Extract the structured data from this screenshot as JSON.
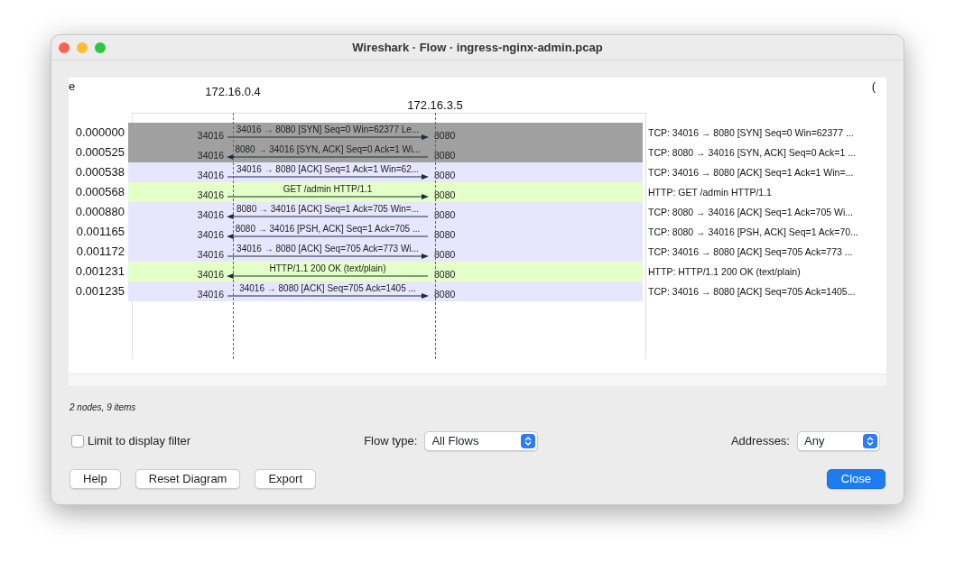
{
  "window": {
    "title": "Wireshark · Flow · ingress-nginx-admin.pcap"
  },
  "columns": {
    "column_1": "e",
    "column_2": "("
  },
  "nodes": [
    {
      "address": "172.16.0.4"
    },
    {
      "address": "172.16.3.5"
    }
  ],
  "rows": [
    {
      "time": "0.000000",
      "left_port": "34016",
      "right_port": "8080",
      "label": "34016 → 8080 [SYN] Seq=0 Win=62377 Le...",
      "rightward": true,
      "color": "#a0a0a0",
      "comment": "TCP: 34016 → 8080 [SYN] Seq=0 Win=62377 ..."
    },
    {
      "time": "0.000525",
      "left_port": "34016",
      "right_port": "8080",
      "label": "8080 → 34016 [SYN, ACK] Seq=0 Ack=1 Wi...",
      "rightward": false,
      "color": "#a0a0a0",
      "comment": "TCP: 8080 → 34016 [SYN, ACK] Seq=0 Ack=1 ..."
    },
    {
      "time": "0.000538",
      "left_port": "34016",
      "right_port": "8080",
      "label": "34016 → 8080 [ACK] Seq=1 Ack=1 Win=62...",
      "rightward": true,
      "color": "#e7e6ff",
      "comment": "TCP: 34016 → 8080 [ACK] Seq=1 Ack=1 Win=..."
    },
    {
      "time": "0.000568",
      "left_port": "34016",
      "right_port": "8080",
      "label": "GET /admin HTTP/1.1",
      "rightward": true,
      "color": "#e4ffc7",
      "comment": "HTTP: GET /admin HTTP/1.1"
    },
    {
      "time": "0.000880",
      "left_port": "34016",
      "right_port": "8080",
      "label": "8080 → 34016 [ACK] Seq=1 Ack=705 Win=...",
      "rightward": false,
      "color": "#e7e6ff",
      "comment": "TCP: 8080 → 34016 [ACK] Seq=1 Ack=705 Wi..."
    },
    {
      "time": "0.001165",
      "left_port": "34016",
      "right_port": "8080",
      "label": "8080 → 34016 [PSH, ACK] Seq=1 Ack=705 ...",
      "rightward": false,
      "color": "#e7e6ff",
      "comment": "TCP: 8080 → 34016 [PSH, ACK] Seq=1 Ack=70..."
    },
    {
      "time": "0.001172",
      "left_port": "34016",
      "right_port": "8080",
      "label": "34016 → 8080 [ACK] Seq=705 Ack=773 Wi...",
      "rightward": true,
      "color": "#e7e6ff",
      "comment": "TCP: 34016 → 8080 [ACK] Seq=705 Ack=773 ..."
    },
    {
      "time": "0.001231",
      "left_port": "34016",
      "right_port": "8080",
      "label": "HTTP/1.1 200 OK  (text/plain)",
      "rightward": false,
      "color": "#e4ffc7",
      "comment": "HTTP: HTTP/1.1 200 OK  (text/plain)"
    },
    {
      "time": "0.001235",
      "left_port": "34016",
      "right_port": "8080",
      "label": "34016 → 8080 [ACK] Seq=705 Ack=1405 ...",
      "rightward": true,
      "color": "#e7e6ff",
      "comment": "TCP: 34016 → 8080 [ACK] Seq=705 Ack=1405..."
    }
  ],
  "status": "2 nodes, 9 items",
  "limit_filter": {
    "label": "Limit to display filter",
    "checked": false
  },
  "flow_type": {
    "label": "Flow type:",
    "value": "All Flows"
  },
  "addresses": {
    "label": "Addresses:",
    "value": "Any"
  },
  "buttons": [
    {
      "label": "Help",
      "kind": "plain"
    },
    {
      "label": "Reset Diagram",
      "kind": "plain"
    },
    {
      "label": "Export",
      "kind": "plain"
    },
    {
      "label": "Close",
      "kind": "default"
    }
  ]
}
